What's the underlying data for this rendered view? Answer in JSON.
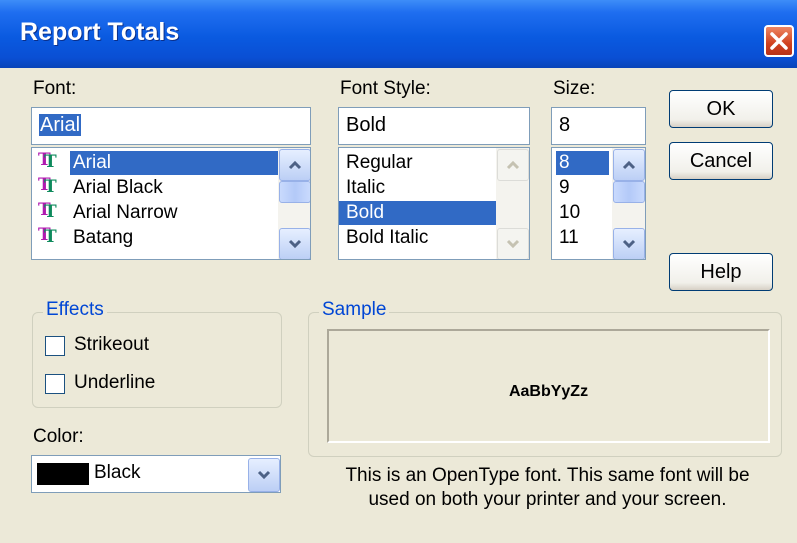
{
  "window": {
    "title": "Report Totals"
  },
  "font": {
    "label": "Font:",
    "value": "Arial",
    "items": [
      "Arial",
      "Arial Black",
      "Arial Narrow",
      "Batang"
    ],
    "selected": "Arial"
  },
  "style": {
    "label": "Font Style:",
    "value": "Bold",
    "items": [
      "Regular",
      "Italic",
      "Bold",
      "Bold Italic"
    ],
    "selected": "Bold"
  },
  "size": {
    "label": "Size:",
    "value": "8",
    "items": [
      "8",
      "9",
      "10",
      "11"
    ],
    "selected": "8"
  },
  "buttons": {
    "ok": "OK",
    "cancel": "Cancel",
    "help": "Help"
  },
  "effects": {
    "legend": "Effects",
    "strikeout": "Strikeout",
    "underline": "Underline",
    "strikeout_checked": false,
    "underline_checked": false
  },
  "color": {
    "label": "Color:",
    "value": "Black",
    "swatch": "#000000"
  },
  "sample": {
    "legend": "Sample",
    "text": "AaBbYyZz"
  },
  "info": {
    "line1": "This is an OpenType font. This same font will be",
    "line2": "used on both your printer and your screen."
  },
  "colors": {
    "titlebar": "#0a5ae0",
    "selection": "#316ac5",
    "group_legend": "#0046d5",
    "dialog_bg": "#ece9d8",
    "close": "#d0411e"
  },
  "icons": {
    "font_item": "truetype-font-icon",
    "close": "close-icon"
  }
}
